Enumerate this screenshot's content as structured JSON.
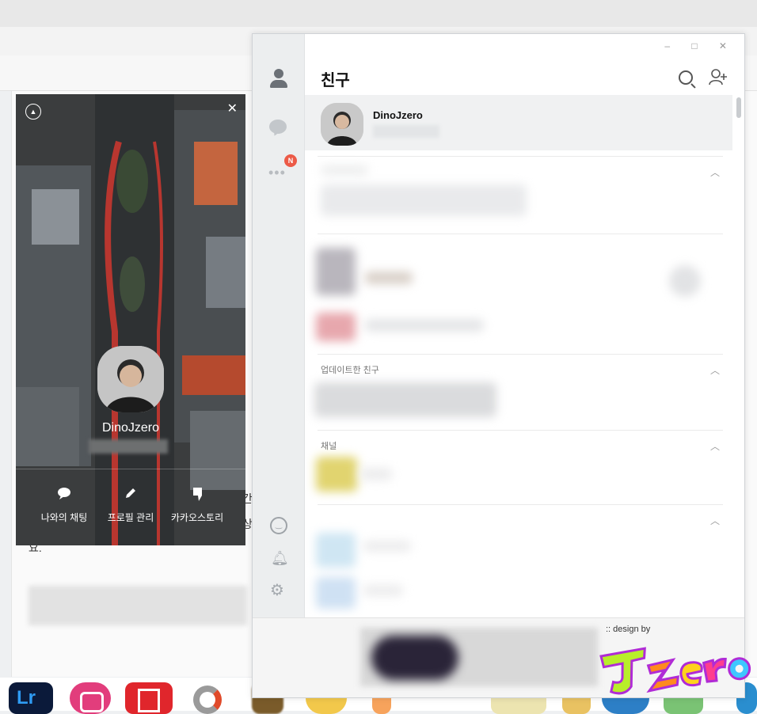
{
  "window_title": "친구",
  "sidebar": {
    "badge": "N",
    "icons": [
      "person-icon",
      "chat-icon",
      "more-icon",
      "emoji-icon",
      "bell-icon",
      "gear-icon"
    ]
  },
  "header": {
    "window_controls": "–  □  ✕",
    "title": "친구"
  },
  "my_profile": {
    "name": "DinoJzero"
  },
  "sections": {
    "updated_friends": "업데이트한 친구",
    "channel": "채널"
  },
  "profile_card": {
    "name": "DinoJzero",
    "close": "✕",
    "actions": [
      {
        "label": "나와의 채팅",
        "icon": "chat-bubble-icon"
      },
      {
        "label": "프로필 관리",
        "icon": "pencil-icon"
      },
      {
        "label": "카카오스토리",
        "icon": "quote-icon"
      }
    ]
  },
  "footer": {
    "design_by": ":: design by",
    "logo_text": "JZero"
  },
  "background_page": {
    "fragment_1": "간",
    "fragment_2": "요.",
    "fragment_3": "상"
  },
  "taskbar": {
    "lr_label": "Lr"
  },
  "colors": {
    "accent_badge": "#ec5a47",
    "selected_row": "#f0f1f2"
  }
}
